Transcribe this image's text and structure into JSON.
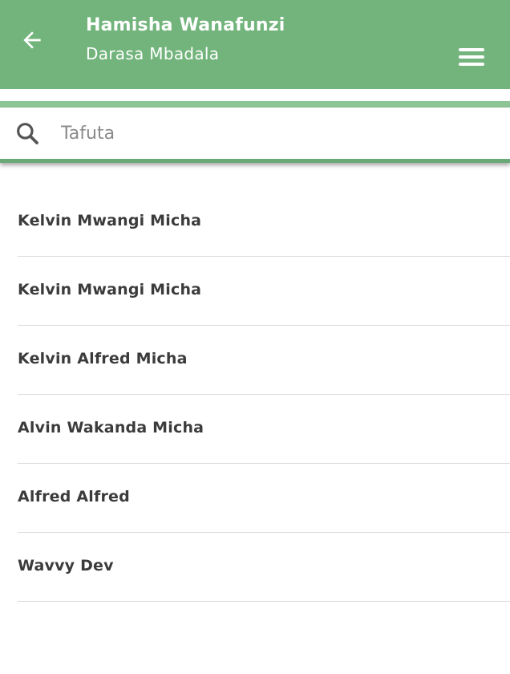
{
  "header": {
    "title": "Hamisha Wanafunzi",
    "subtitle": "Darasa Mbadala",
    "back_icon": "arrow-left-icon",
    "menu_icon": "hamburger-menu-icon",
    "background_color": "#72b47c"
  },
  "search": {
    "icon": "search-icon",
    "placeholder": "Tafuta",
    "value": ""
  },
  "students": [
    {
      "name": "Kelvin Mwangi Micha"
    },
    {
      "name": "Kelvin Mwangi Micha"
    },
    {
      "name": "Kelvin Alfred Micha"
    },
    {
      "name": "Alvin Wakanda Micha"
    },
    {
      "name": "Alfred Alfred"
    },
    {
      "name": "Wavvy Dev"
    }
  ]
}
